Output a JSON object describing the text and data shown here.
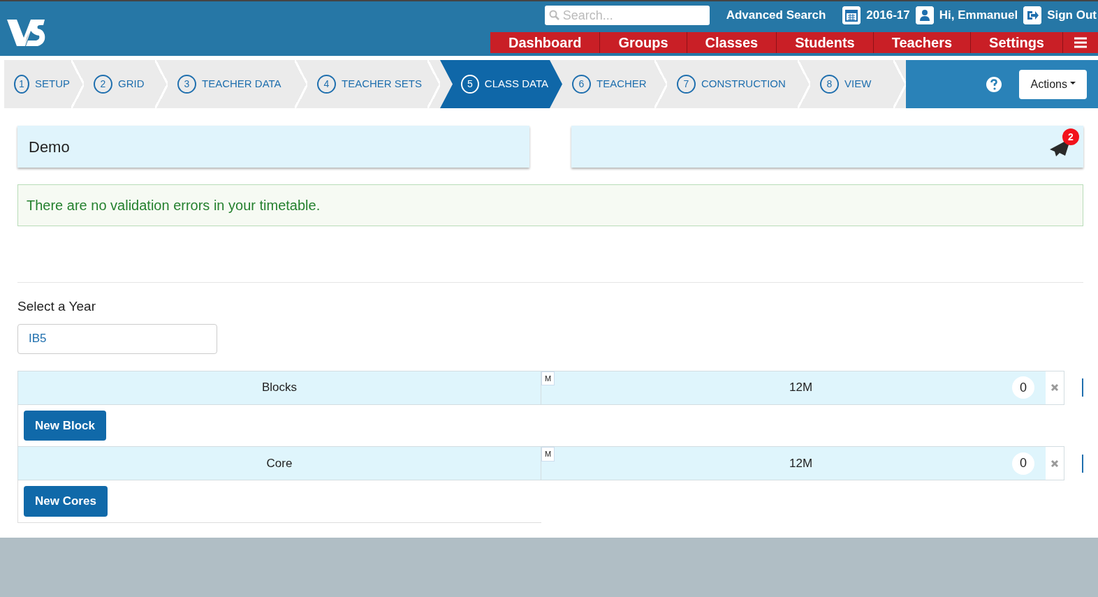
{
  "header": {
    "search": {
      "placeholder": "Search..."
    },
    "advanced_search": "Advanced Search",
    "year": "2016-17",
    "greeting": "Hi, Emmanuel",
    "sign_out": "Sign Out"
  },
  "nav": [
    {
      "label": "Dashboard"
    },
    {
      "label": "Groups"
    },
    {
      "label": "Classes"
    },
    {
      "label": "Students"
    },
    {
      "label": "Teachers"
    },
    {
      "label": "Settings"
    }
  ],
  "steps": [
    {
      "number": "1",
      "label": "SETUP",
      "selected": false
    },
    {
      "number": "2",
      "label": "GRID",
      "selected": false
    },
    {
      "number": "3",
      "label": "TEACHER DATA",
      "selected": false
    },
    {
      "number": "4",
      "label": "TEACHER SETS",
      "selected": false
    },
    {
      "number": "5",
      "label": "CLASS DATA",
      "selected": true
    },
    {
      "number": "6",
      "label": "TEACHER",
      "selected": false
    },
    {
      "number": "7",
      "label": "CONSTRUCTION",
      "selected": false
    },
    {
      "number": "8",
      "label": "VIEW",
      "selected": false
    }
  ],
  "actions": "Actions",
  "timetable": {
    "title": "Demo",
    "notifications": "2"
  },
  "alert": "There are no validation errors in your timetable.",
  "year_select": {
    "label": "Select a Year",
    "value": "IB5"
  },
  "sections": [
    {
      "title": "Blocks",
      "tag": "M",
      "value": "12M",
      "count": "0",
      "button": "New Block"
    },
    {
      "title": "Core",
      "tag": "M",
      "value": "12M",
      "count": "0",
      "button": "New Cores"
    }
  ]
}
